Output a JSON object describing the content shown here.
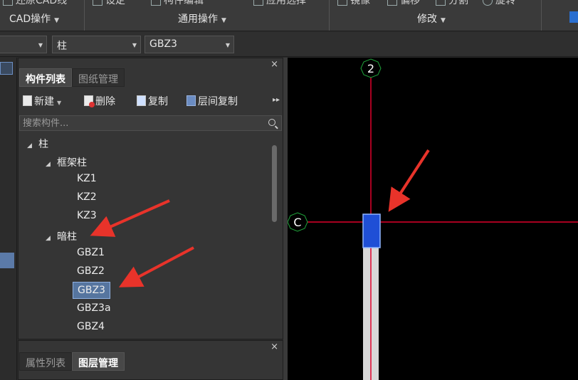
{
  "ribbon": {
    "clipped_items": [
      "还原CAD线",
      "设定",
      "构件编辑",
      "应用选择",
      "镜像",
      "偏移",
      "分割",
      "旋转"
    ],
    "groups": [
      {
        "label": "CAD操作"
      },
      {
        "label": "通用操作"
      },
      {
        "label": "修改"
      }
    ]
  },
  "toolbar": {
    "floor_select": "柱",
    "component_select": "GBZ3"
  },
  "panel": {
    "tabs": [
      {
        "label": "构件列表",
        "active": true
      },
      {
        "label": "图纸管理",
        "active": false
      }
    ],
    "actions": {
      "new": "新建",
      "delete": "删除",
      "copy": "复制",
      "floor_copy": "层间复制"
    },
    "search": {
      "placeholder": "搜索构件..."
    },
    "tree": {
      "root": "柱",
      "groups": [
        {
          "label": "框架柱",
          "items": [
            "KZ1",
            "KZ2",
            "KZ3"
          ]
        },
        {
          "label": "暗柱",
          "items": [
            "GBZ1",
            "GBZ2",
            "GBZ3",
            "GBZ3a",
            "GBZ4"
          ]
        }
      ],
      "selected": "GBZ3"
    }
  },
  "panel2": {
    "tabs": [
      {
        "label": "属性列表",
        "active": false
      },
      {
        "label": "图层管理",
        "active": true
      }
    ]
  },
  "canvas": {
    "axis_labels": {
      "vertical": "2",
      "horizontal": "C"
    },
    "colors": {
      "background": "#000000",
      "axis_line": "#e0002a",
      "axis_bubble": "#1fa33a",
      "column_selected": "#1f4fd6",
      "wall": "#d8d8d8",
      "annotation_arrow": "#e8332a"
    }
  },
  "annotation": {
    "arrow_color": "#e8332a"
  }
}
